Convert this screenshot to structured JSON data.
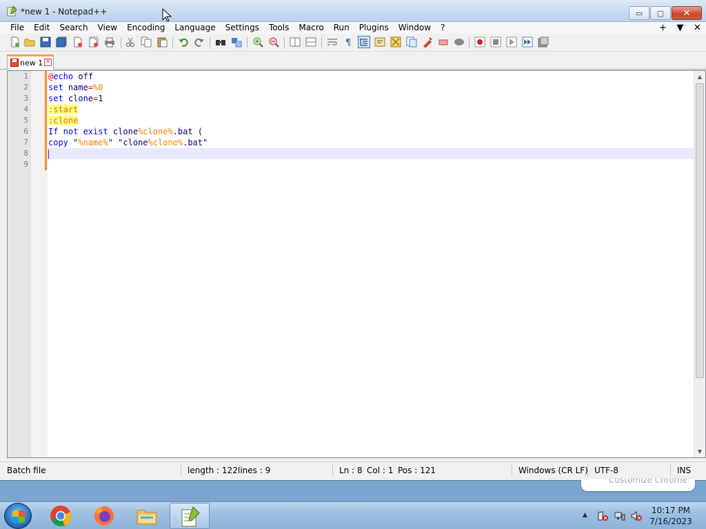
{
  "window": {
    "title": "*new 1 - Notepad++",
    "controls": {
      "minimize": "▭",
      "maximize": "▢",
      "close": "✕"
    }
  },
  "menubar": {
    "items": [
      "File",
      "Edit",
      "Search",
      "View",
      "Encoding",
      "Language",
      "Settings",
      "Tools",
      "Macro",
      "Run",
      "Plugins",
      "Window",
      "?"
    ],
    "right": [
      "+",
      "▼",
      "✕"
    ]
  },
  "toolbar": {
    "icons": [
      "new-file-icon",
      "open-file-icon",
      "save-icon",
      "save-all-icon",
      "close-icon",
      "close-all-icon",
      "print-icon",
      "cut-icon",
      "copy-icon",
      "paste-icon",
      "undo-icon",
      "redo-icon",
      "find-icon",
      "replace-icon",
      "zoom-in-icon",
      "zoom-out-icon",
      "sync-vertical-icon",
      "sync-horizontal-icon",
      "word-wrap-icon",
      "show-all-chars-icon",
      "indent-guide-icon",
      "udl-icon",
      "doc-map-icon",
      "function-list-icon",
      "folder-workspace-icon",
      "monitor-icon",
      "macro-record-icon",
      "macro-stop-icon",
      "macro-play-icon",
      "macro-run-multiple-icon",
      "macro-save-icon"
    ]
  },
  "tabs": [
    {
      "label": "new 1",
      "close": "✕"
    }
  ],
  "editor": {
    "line_numbers": [
      "1",
      "2",
      "3",
      "4",
      "5",
      "6",
      "7",
      "8",
      "9"
    ],
    "lines": [
      [
        {
          "t": "@",
          "c": "op"
        },
        {
          "t": "echo",
          "c": "kw"
        },
        {
          "t": " off",
          "c": "plain"
        }
      ],
      [
        {
          "t": "set",
          "c": "kw"
        },
        {
          "t": " name",
          "c": "plain"
        },
        {
          "t": "=",
          "c": "op"
        },
        {
          "t": "%0",
          "c": "var"
        }
      ],
      [
        {
          "t": "set",
          "c": "kw"
        },
        {
          "t": " clone",
          "c": "plain"
        },
        {
          "t": "=",
          "c": "op"
        },
        {
          "t": "1",
          "c": "plain"
        }
      ],
      [
        {
          "t": ":start",
          "c": "lbl"
        }
      ],
      [
        {
          "t": ":clone",
          "c": "lbl"
        }
      ],
      [
        {
          "t": "If not exist",
          "c": "kw"
        },
        {
          "t": " clone",
          "c": "plain"
        },
        {
          "t": "%clone%",
          "c": "var"
        },
        {
          "t": ".bat (",
          "c": "plain"
        }
      ],
      [
        {
          "t": "copy",
          "c": "kw"
        },
        {
          "t": " \"",
          "c": "plain"
        },
        {
          "t": "%name%",
          "c": "var"
        },
        {
          "t": "\" \"clone",
          "c": "plain"
        },
        {
          "t": "%clone%",
          "c": "var"
        },
        {
          "t": ".bat\"",
          "c": "plain"
        }
      ],
      [],
      []
    ],
    "current_line": 8
  },
  "statusbar": {
    "file_type": "Batch file",
    "length": "length : 122",
    "lines": "lines : 9",
    "ln": "Ln : 8",
    "col": "Col : 1",
    "pos": "Pos : 121",
    "eol": "Windows (CR LF)",
    "encoding": "UTF-8",
    "mode": "INS"
  },
  "behind_window_text": "Customize Chrome",
  "taskbar": {
    "apps": [
      "chrome-icon",
      "firefox-icon",
      "file-explorer-icon",
      "notepadpp-icon"
    ],
    "tray_arrow": "▲",
    "time": "10:17 PM",
    "date": "7/16/2023"
  },
  "colors": {
    "accent_tab": "#f7a24a",
    "change_bar": "#ff8a1f",
    "current_line": "#e8e8ff"
  }
}
